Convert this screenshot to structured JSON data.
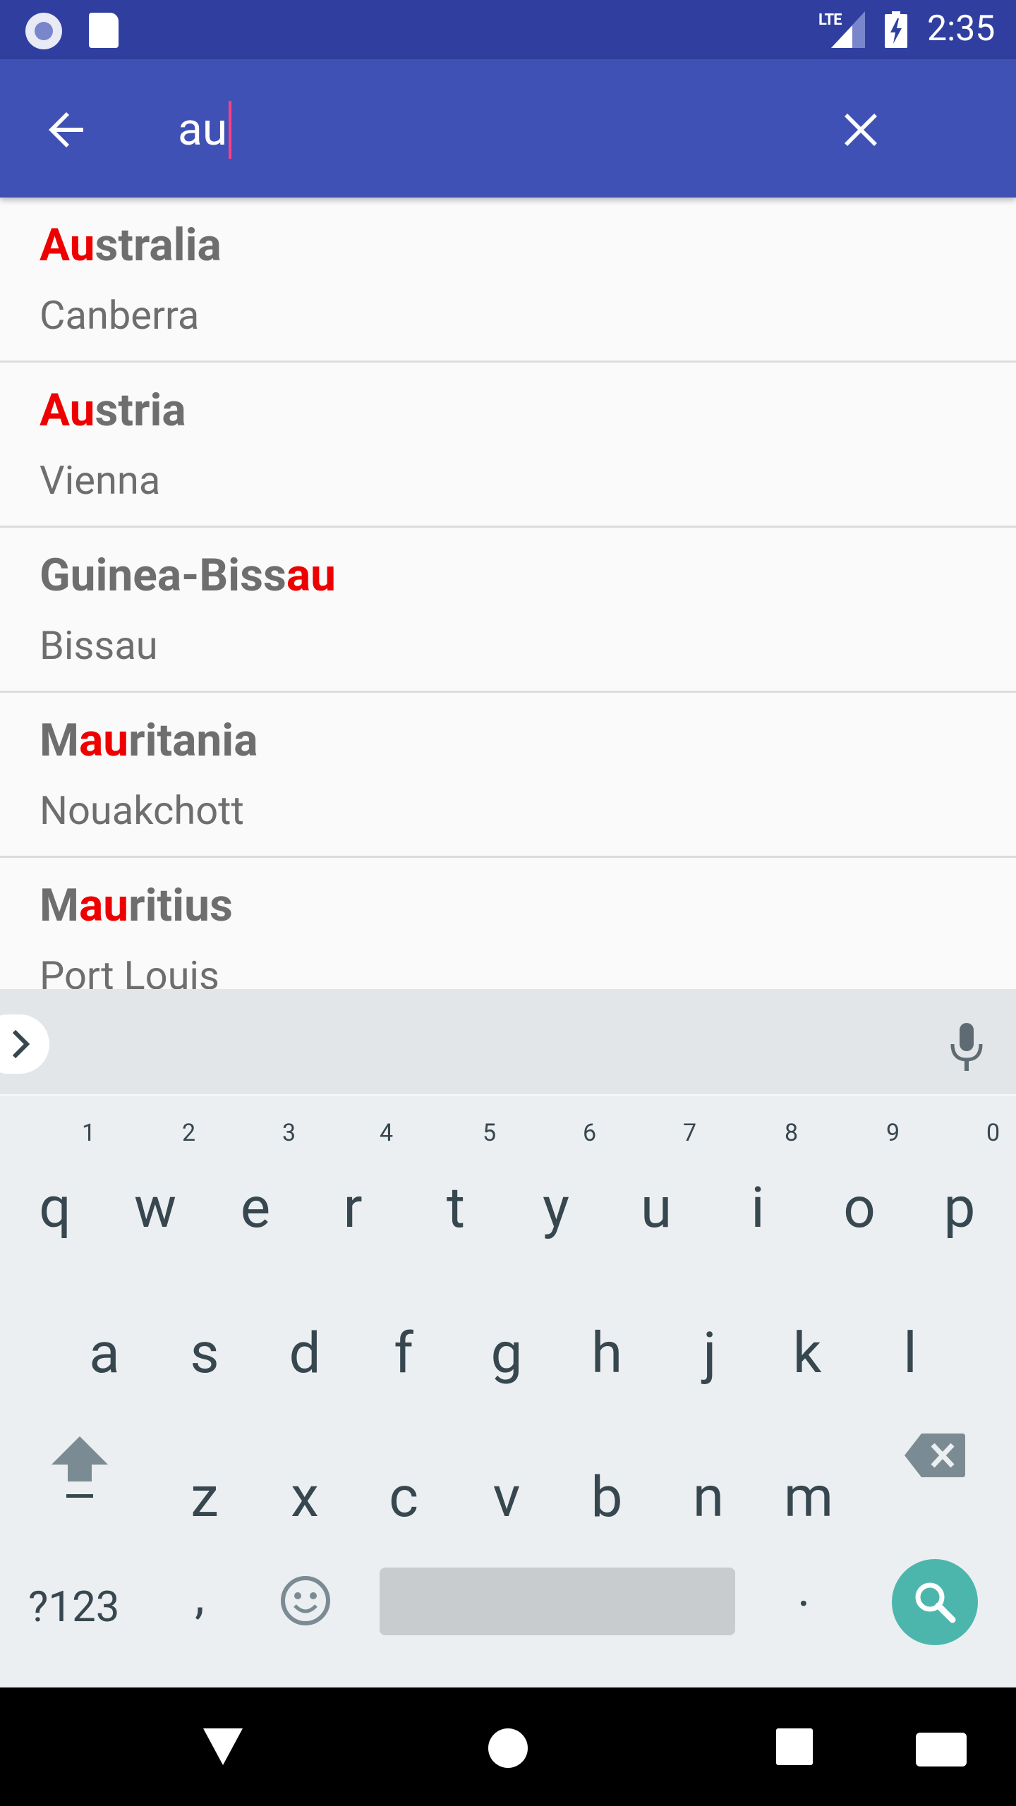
{
  "status_bar": {
    "network": "LTE",
    "time": "2:35"
  },
  "toolbar": {
    "search_value": "au",
    "back_icon": "arrow-back-icon",
    "clear_icon": "close-icon"
  },
  "results": [
    {
      "country_pre": "",
      "country_match": "Au",
      "country_post": "stralia",
      "capital": "Canberra"
    },
    {
      "country_pre": "",
      "country_match": "Au",
      "country_post": "stria",
      "capital": "Vienna"
    },
    {
      "country_pre": "Guinea-Biss",
      "country_match": "au",
      "country_post": "",
      "capital": "Bissau"
    },
    {
      "country_pre": "M",
      "country_match": "au",
      "country_post": "ritania",
      "capital": "Nouakchott"
    },
    {
      "country_pre": "M",
      "country_match": "au",
      "country_post": "ritius",
      "capital": "Port Louis"
    }
  ],
  "keyboard": {
    "row1": [
      "q",
      "w",
      "e",
      "r",
      "t",
      "y",
      "u",
      "i",
      "o",
      "p"
    ],
    "row1_hints": [
      "1",
      "2",
      "3",
      "4",
      "5",
      "6",
      "7",
      "8",
      "9",
      "0"
    ],
    "row2": [
      "a",
      "s",
      "d",
      "f",
      "g",
      "h",
      "j",
      "k",
      "l"
    ],
    "row3": [
      "z",
      "x",
      "c",
      "v",
      "b",
      "n",
      "m"
    ],
    "symbols_label": "?123",
    "comma": ",",
    "period": ".",
    "action_icon": "search-icon"
  },
  "colors": {
    "status_bar": "#303f9f",
    "toolbar": "#3f51b5",
    "highlight": "#ee0000",
    "cursor": "#ff4081",
    "search_key": "#4db6ac"
  }
}
